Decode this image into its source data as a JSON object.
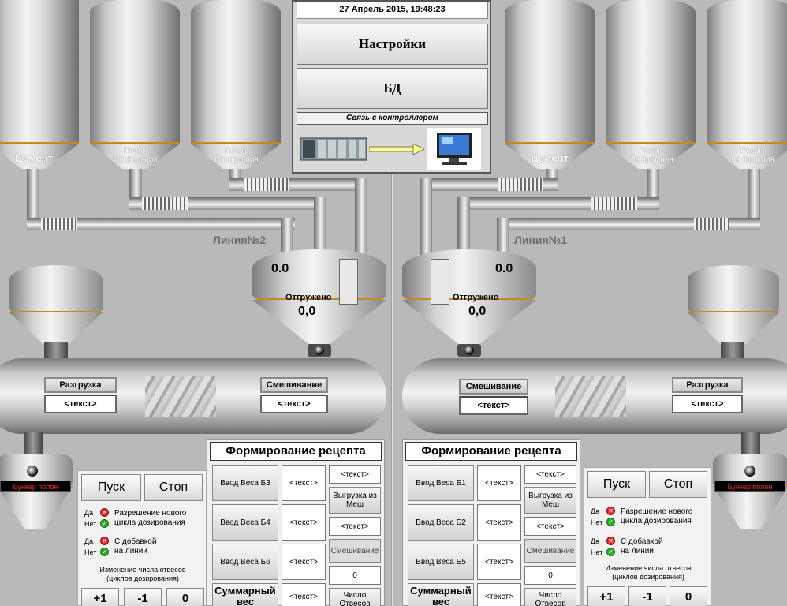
{
  "header": {
    "datetime": "27 Апрель 2015, 19:48:23",
    "settings_button": "Настройки",
    "db_button": "БД",
    "controller_link": "Связь с контроллером"
  },
  "line_left": {
    "name": "Линия№2",
    "silos": [
      {
        "label": "Цемент"
      },
      {
        "label": "Песок\n3-я фракция"
      },
      {
        "label": "Песок\n1-я фракция"
      }
    ],
    "weigher": {
      "value": "0.0",
      "shipped_label": "Отгружено",
      "shipped_value": "0,0",
      "level": 0
    },
    "mixer": {
      "unload_caption": "Разгрузка",
      "unload_value": "<текст>",
      "mix_caption": "Смешивание",
      "mix_value": "<текст>"
    },
    "bunker_full": "Бункер полон",
    "recipe": {
      "title": "Формирование рецепта",
      "inputs": [
        {
          "button": "Ввод Веса Б3",
          "value": "<текст>"
        },
        {
          "button": "Ввод Веса Б4",
          "value": "<текст>"
        },
        {
          "button": "Ввод Веса Б6",
          "value": "<текст>"
        }
      ],
      "total_label": "Суммарный вес",
      "total_value": "<текст>",
      "right_col": {
        "top_value": "<текст>",
        "unload_bags": "Выгрузка из Меш",
        "second_value": "<текст>",
        "mixing": "Смешивание",
        "zero": "0",
        "count_label": "Число Отвесов"
      }
    },
    "control": {
      "start": "Пуск",
      "stop": "Стоп",
      "opt1": {
        "yes": "Да",
        "no": "Нет",
        "text": "Разрешение нового\nцикла дозирования"
      },
      "opt2": {
        "yes": "Да",
        "no": "Нет",
        "text": "С добавкой\nна линии"
      },
      "cycles_label": "Изменение числа отвесов\n(циклов дозирования)",
      "plus": "+1",
      "minus": "-1",
      "zero": "0"
    }
  },
  "line_right": {
    "name": "Линия№1",
    "silos": [
      {
        "label": "Цемент"
      },
      {
        "label": "Песок\n1-я фракция"
      },
      {
        "label": "Песок\n2-я фракция"
      }
    ],
    "weigher": {
      "value": "0.0",
      "shipped_label": "Отгружено",
      "shipped_value": "0,0",
      "level": 0
    },
    "mixer": {
      "mix_caption": "Смешивание",
      "mix_value": "<текст>",
      "unload_caption": "Разгрузка",
      "unload_value": "<текст>"
    },
    "bunker_full": "Бункер полон",
    "recipe": {
      "title": "Формирование рецепта",
      "inputs": [
        {
          "button": "Ввод Веса Б1",
          "value": "<текст>"
        },
        {
          "button": "Ввод Веса Б2",
          "value": "<текст>"
        },
        {
          "button": "Ввод Веса Б5",
          "value": "<текст>"
        }
      ],
      "total_label": "Суммарный вес",
      "total_value": "<текст>",
      "right_col": {
        "top_value": "<текст>",
        "unload_bags": "Выгрузка из Меш",
        "second_value": "<текст>",
        "mixing": "Смешивание",
        "zero": "0",
        "count_label": "Число Отвесов"
      }
    },
    "control": {
      "start": "Пуск",
      "stop": "Стоп",
      "opt1": {
        "yes": "Да",
        "no": "Нет",
        "text": "Разрешение нового\nцикла дозирования"
      },
      "opt2": {
        "yes": "Да",
        "no": "Нет",
        "text": "С добавкой\nна линии"
      },
      "cycles_label": "Изменение числа отвесов\n(циклов дозирования)",
      "plus": "+1",
      "minus": "-1",
      "zero": "0"
    }
  },
  "icons": {
    "plc": "plc-controller-icon",
    "arrow": "arrow-right-icon",
    "monitor": "monitor-icon",
    "deny": "red-cross-icon",
    "allow": "green-check-icon"
  },
  "colors": {
    "background": "#b9b9b9",
    "accent_ring": "#c48a22",
    "alarm_text": "#ff2a2a",
    "deny": "#e03030",
    "allow": "#2fae2f"
  }
}
